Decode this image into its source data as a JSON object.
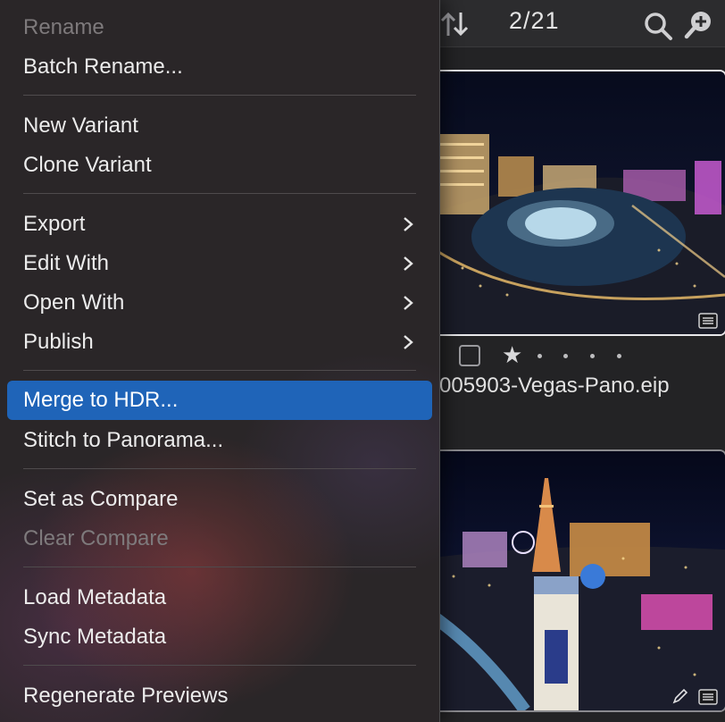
{
  "browser": {
    "counter": "2/21",
    "icons": [
      "sort-icon",
      "search-icon",
      "zoom-in-icon",
      "metadata-icon",
      "pencil-icon"
    ],
    "thumbnail_1": {
      "filename": "005903-Vegas-Pano.eip",
      "rating_stars": 1,
      "rating_max": 5,
      "selected": true
    },
    "thumbnail_2": {
      "selected": false
    }
  },
  "menu": {
    "items": [
      {
        "label": "Rename",
        "disabled": true
      },
      {
        "label": "Batch Rename..."
      },
      {
        "label": "New Variant"
      },
      {
        "label": "Clone Variant"
      },
      {
        "label": "Export",
        "submenu": true
      },
      {
        "label": "Edit With",
        "submenu": true
      },
      {
        "label": "Open With",
        "submenu": true
      },
      {
        "label": "Publish",
        "submenu": true
      },
      {
        "label": "Merge to HDR...",
        "highlighted": true
      },
      {
        "label": "Stitch to Panorama..."
      },
      {
        "label": "Set as Compare"
      },
      {
        "label": "Clear Compare",
        "disabled": true
      },
      {
        "label": "Load Metadata"
      },
      {
        "label": "Sync Metadata"
      },
      {
        "label": "Regenerate Previews"
      }
    ],
    "highlight_color": "#1f64b8"
  }
}
